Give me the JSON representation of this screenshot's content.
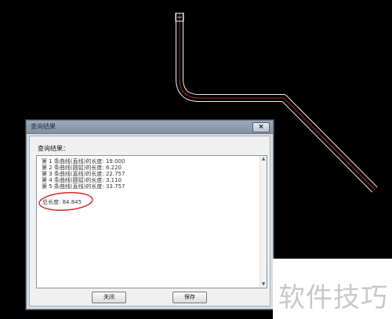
{
  "dialog": {
    "title": "查询结果",
    "close_label": "×",
    "result_label": "查询结果：",
    "lines": [
      "第 1 条曲线(直线)的长度: 19.000",
      "第 2 条曲线(圆弧)的长度: 6.220",
      "第 3 条曲线(直线)的长度: 22.757",
      "第 4 条曲线(圆弧)的长度: 3.110",
      "第 5 条曲线(直线)的长度: 33.757"
    ],
    "total": "总长度: 84.845",
    "scroll_up": "▲",
    "scroll_down": "▼",
    "buttons": {
      "close": "关闭",
      "save": "保存"
    }
  },
  "watermark": "软件技巧",
  "colors": {
    "canvas_bg": "#000000",
    "curve_outline": "#f2f2f2",
    "curve_center": "#c0202a",
    "annotation_circle": "#d42a2a"
  }
}
